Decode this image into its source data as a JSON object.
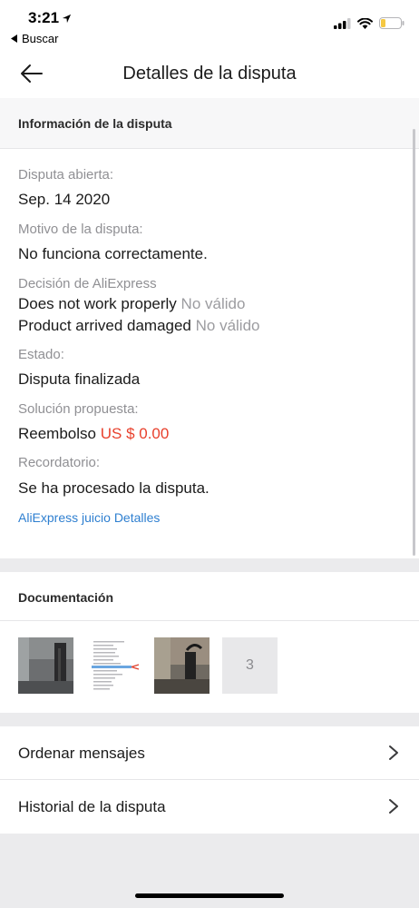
{
  "status_bar": {
    "time": "3:21",
    "back_app": "Buscar"
  },
  "header": {
    "title": "Detalles de la disputa"
  },
  "info_section": {
    "heading": "Información de la disputa",
    "opened_label": "Disputa abierta:",
    "opened_value": "Sep. 14 2020",
    "reason_label": "Motivo de la disputa:",
    "reason_value": "No funciona correctamente.",
    "decision_label": "Decisión de AliExpress",
    "decisions": [
      {
        "text": "Does not work properly",
        "status": "No válido"
      },
      {
        "text": "Product arrived damaged",
        "status": "No válido"
      }
    ],
    "state_label": "Estado:",
    "state_value": "Disputa finalizada",
    "solution_label": "Solución propuesta:",
    "solution_text": "Reembolso",
    "solution_amount": "US $ 0.00",
    "reminder_label": "Recordatorio:",
    "reminder_value": "Se ha procesado la disputa.",
    "link": "AliExpress juicio Detalles"
  },
  "docs_section": {
    "heading": "Documentación",
    "more_count": "3"
  },
  "list": {
    "items": [
      {
        "label": "Ordenar mensajes"
      },
      {
        "label": "Historial de la disputa"
      }
    ]
  },
  "colors": {
    "accent_link": "#2e7fd0",
    "amount_red": "#e8402c",
    "battery_yellow": "#f5c842"
  }
}
